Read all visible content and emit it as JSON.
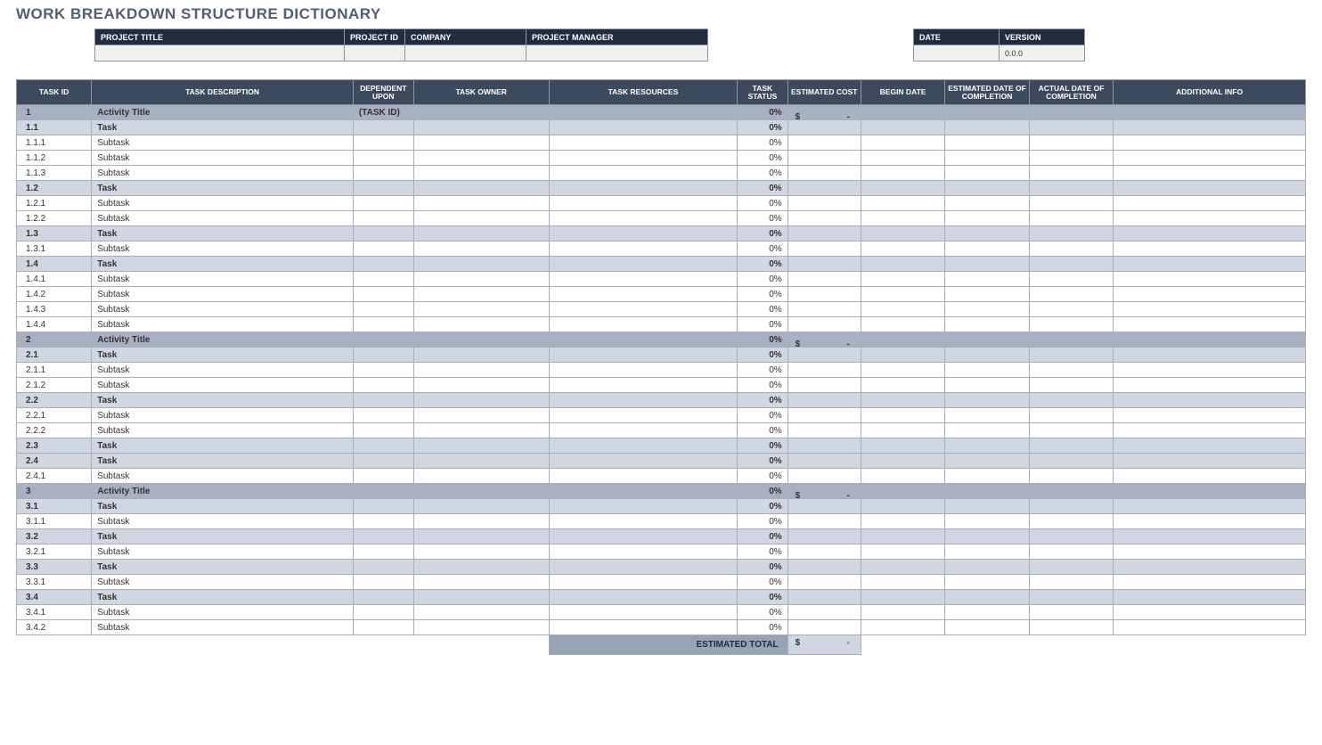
{
  "title": "WORK BREAKDOWN STRUCTURE DICTIONARY",
  "meta": {
    "headers": {
      "project_title": "PROJECT TITLE",
      "project_id": "PROJECT ID",
      "company": "COMPANY",
      "project_manager": "PROJECT MANAGER",
      "date": "DATE",
      "version": "VERSION"
    },
    "values": {
      "project_title": "",
      "project_id": "",
      "company": "",
      "project_manager": "",
      "date": "",
      "version": "0.0.0"
    }
  },
  "columns": {
    "task_id": "TASK ID",
    "task_description": "TASK DESCRIPTION",
    "dependent_upon": "DEPENDENT UPON",
    "task_owner": "TASK OWNER",
    "task_resources": "TASK RESOURCES",
    "task_status": "TASK STATUS",
    "estimated_cost": "ESTIMATED COST",
    "begin_date": "BEGIN DATE",
    "estimated_completion": "ESTIMATED DATE OF COMPLETION",
    "actual_completion": "ACTUAL DATE OF COMPLETION",
    "additional_info": "ADDITIONAL INFO"
  },
  "currency_symbol": "$",
  "cost_placeholder": "-",
  "rows": [
    {
      "level": "activity",
      "id": "1",
      "desc": "Activity Title",
      "dep": "(TASK ID)",
      "status": "0%",
      "cost": true
    },
    {
      "level": "task",
      "id": "1.1",
      "desc": "Task",
      "status": "0%"
    },
    {
      "level": "subtask",
      "id": "1.1.1",
      "desc": "Subtask",
      "status": "0%"
    },
    {
      "level": "subtask",
      "id": "1.1.2",
      "desc": "Subtask",
      "status": "0%"
    },
    {
      "level": "subtask",
      "id": "1.1.3",
      "desc": "Subtask",
      "status": "0%"
    },
    {
      "level": "task",
      "id": "1.2",
      "desc": "Task",
      "status": "0%"
    },
    {
      "level": "subtask",
      "id": "1.2.1",
      "desc": "Subtask",
      "status": "0%"
    },
    {
      "level": "subtask",
      "id": "1.2.2",
      "desc": "Subtask",
      "status": "0%"
    },
    {
      "level": "task",
      "id": "1.3",
      "desc": "Task",
      "status": "0%"
    },
    {
      "level": "subtask",
      "id": "1.3.1",
      "desc": "Subtask",
      "status": "0%"
    },
    {
      "level": "task",
      "id": "1.4",
      "desc": "Task",
      "status": "0%"
    },
    {
      "level": "subtask",
      "id": "1.4.1",
      "desc": "Subtask",
      "status": "0%"
    },
    {
      "level": "subtask",
      "id": "1.4.2",
      "desc": "Subtask",
      "status": "0%"
    },
    {
      "level": "subtask",
      "id": "1.4.3",
      "desc": "Subtask",
      "status": "0%"
    },
    {
      "level": "subtask",
      "id": "1.4.4",
      "desc": "Subtask",
      "status": "0%"
    },
    {
      "level": "activity",
      "id": "2",
      "desc": "Activity Title",
      "status": "0%",
      "cost": true
    },
    {
      "level": "task",
      "id": "2.1",
      "desc": "Task",
      "status": "0%"
    },
    {
      "level": "subtask",
      "id": "2.1.1",
      "desc": "Subtask",
      "status": "0%"
    },
    {
      "level": "subtask",
      "id": "2.1.2",
      "desc": "Subtask",
      "status": "0%"
    },
    {
      "level": "task",
      "id": "2.2",
      "desc": "Task",
      "status": "0%"
    },
    {
      "level": "subtask",
      "id": "2.2.1",
      "desc": "Subtask",
      "status": "0%"
    },
    {
      "level": "subtask",
      "id": "2.2.2",
      "desc": "Subtask",
      "status": "0%"
    },
    {
      "level": "task",
      "id": "2.3",
      "desc": "Task",
      "status": "0%"
    },
    {
      "level": "task",
      "id": "2.4",
      "desc": "Task",
      "status": "0%"
    },
    {
      "level": "subtask",
      "id": "2.4.1",
      "desc": "Subtask",
      "status": "0%"
    },
    {
      "level": "activity",
      "id": "3",
      "desc": "Activity Title",
      "status": "0%",
      "cost": true
    },
    {
      "level": "task",
      "id": "3.1",
      "desc": "Task",
      "status": "0%"
    },
    {
      "level": "subtask",
      "id": "3.1.1",
      "desc": "Subtask",
      "status": "0%"
    },
    {
      "level": "task",
      "id": "3.2",
      "desc": "Task",
      "status": "0%"
    },
    {
      "level": "subtask",
      "id": "3.2.1",
      "desc": "Subtask",
      "status": "0%"
    },
    {
      "level": "task",
      "id": "3.3",
      "desc": "Task",
      "status": "0%"
    },
    {
      "level": "subtask",
      "id": "3.3.1",
      "desc": "Subtask",
      "status": "0%"
    },
    {
      "level": "task",
      "id": "3.4",
      "desc": "Task",
      "status": "0%"
    },
    {
      "level": "subtask",
      "id": "3.4.1",
      "desc": "Subtask",
      "status": "0%"
    },
    {
      "level": "subtask",
      "id": "3.4.2",
      "desc": "Subtask",
      "status": "0%"
    }
  ],
  "total": {
    "label": "ESTIMATED TOTAL",
    "value": "-"
  }
}
